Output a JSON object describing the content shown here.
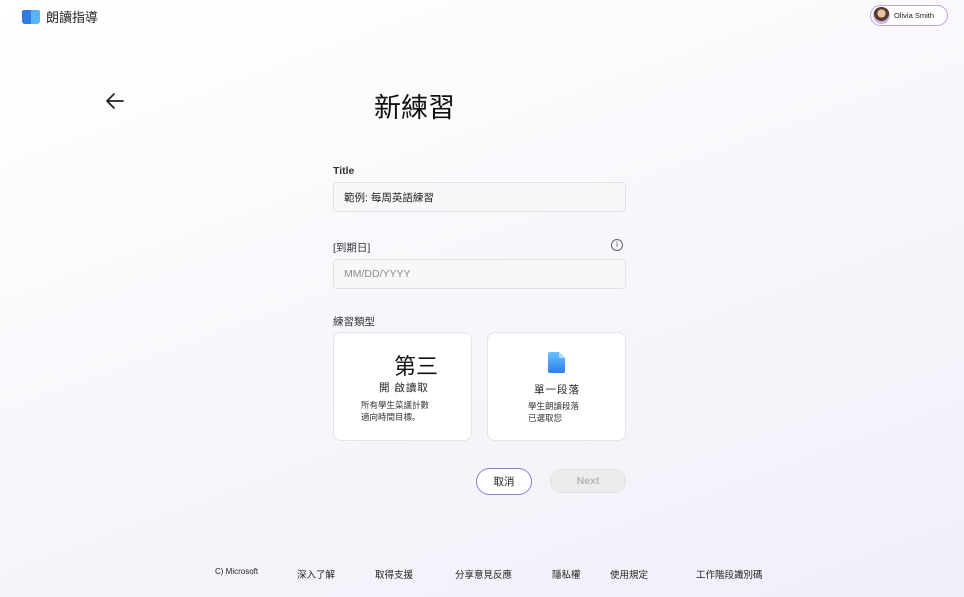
{
  "app": {
    "title": "朗讀指導"
  },
  "user": {
    "name": "Olivia Smith"
  },
  "page": {
    "title": "新練習"
  },
  "form": {
    "title_label": "Title",
    "title_value": "範例: 每周英語練習",
    "due_label": "[到期日]",
    "due_placeholder": "MM/DD/YYYY",
    "type_label": "練習類型"
  },
  "cards": [
    {
      "icon_text": "第三",
      "title": "開 啟讀取",
      "desc_line1": "所有學生菜議計數",
      "desc_line2": "適向時間目標。"
    },
    {
      "icon": "document-icon",
      "title": "單一段落",
      "desc_line1": "學生朗讀段落",
      "desc_line2": "已選取您"
    }
  ],
  "buttons": {
    "cancel": "取消",
    "next": "Next"
  },
  "footer": {
    "copyright": "C) Microsoft",
    "learn_more": "深入了解",
    "support": "取得支援",
    "feedback": "分享意見反應",
    "privacy": "隱私權",
    "terms": "使用規定",
    "session_id": "工作階段識別碼"
  },
  "colors": {
    "accent": "#8f7fd6",
    "logo_blue": "#2f7be0",
    "logo_light": "#58b4f5"
  }
}
